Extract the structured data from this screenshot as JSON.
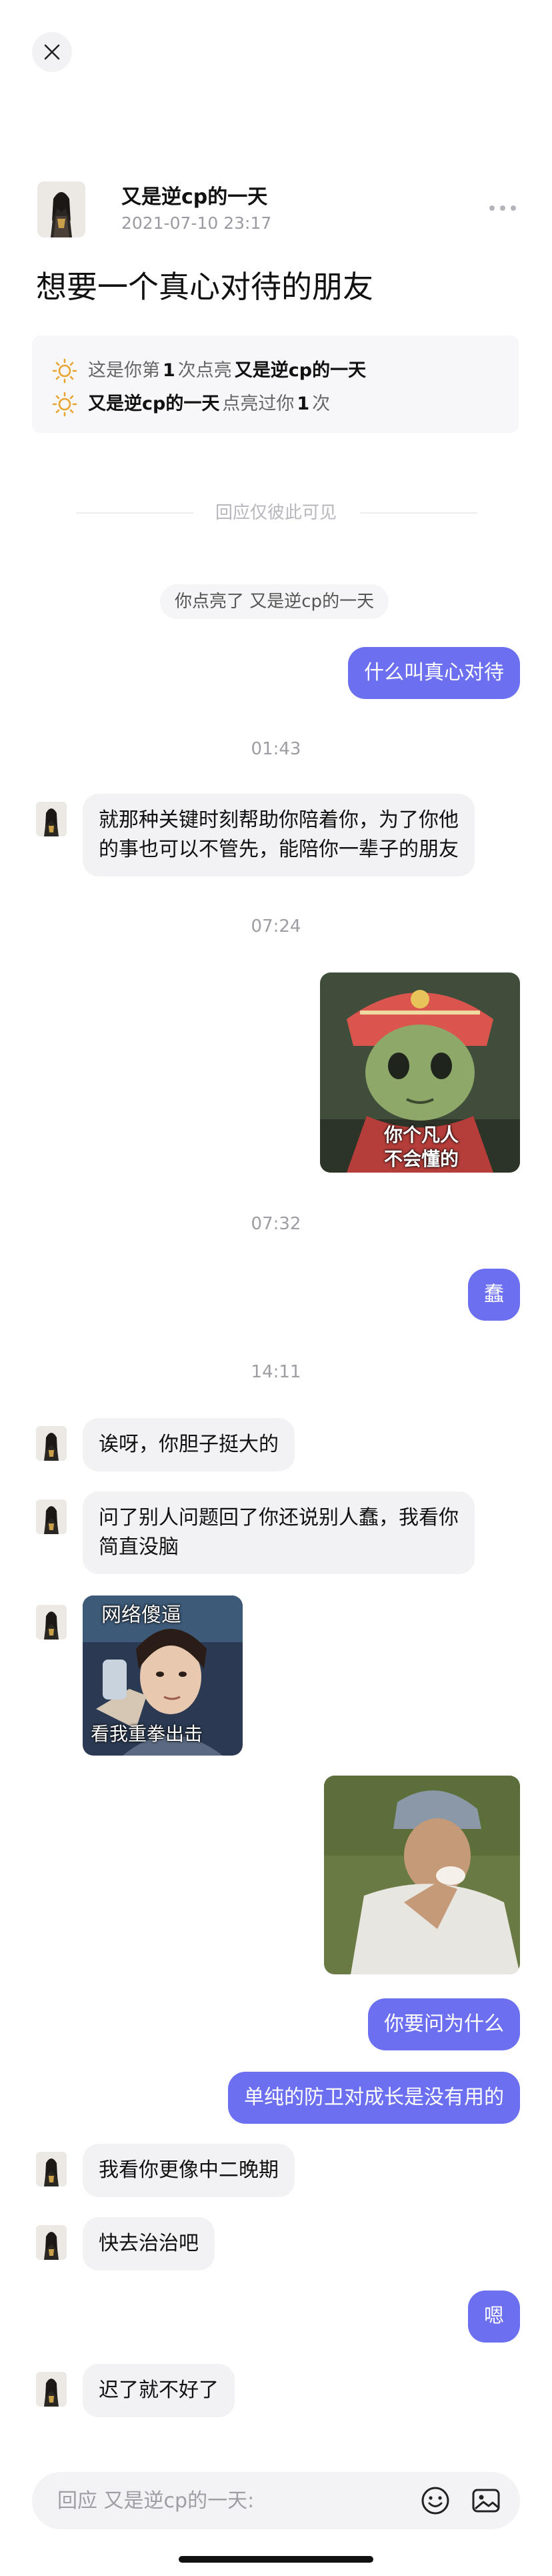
{
  "post": {
    "author_name": "又是逆cp的一天",
    "timestamp": "2021-07-10 23:17",
    "title": "想要一个真心对待的朋友"
  },
  "light_info": {
    "row1_prefix": "这是你第",
    "row1_count": "1",
    "row1_mid": "次点亮",
    "row1_name": "又是逆cp的一天",
    "row2_name": "又是逆cp的一天",
    "row2_mid": "点亮过你",
    "row2_count": "1",
    "row2_suffix": "次"
  },
  "divider_text": "回应仅彼此可见",
  "system_notice": "你点亮了 又是逆cp的一天",
  "times": [
    "01:43",
    "07:24",
    "07:32",
    "14:11"
  ],
  "messages": {
    "m1": "什么叫真心对待",
    "m2_line1": "就那种关键时刻帮助你陪着你，为了你他",
    "m2_line2": "的事也可以不管先，能陪你一辈子的朋友",
    "m3_caption_line1": "你个凡人",
    "m3_caption_line2": "不会懂的",
    "m4": "蠢",
    "m5": "诶呀，你胆子挺大的",
    "m6_line1": "问了别人问题回了你还说别人蠢，我看你",
    "m6_line2": "简直没脑",
    "m7_caption_top": "网络傻逼",
    "m7_caption_bottom": "看我重拳出击",
    "m9": "你要问为什么",
    "m10": "单纯的防卫对成长是没有用的",
    "m11": "我看你更像中二晚期",
    "m12": "快去治治吧",
    "m13": "嗯",
    "m14": "迟了就不好了"
  },
  "composer": {
    "placeholder": "回应 又是逆cp的一天:"
  },
  "icons": {
    "close": "close-icon",
    "more": "more-icon",
    "sun": "sun-icon",
    "emoji": "emoji-icon",
    "image": "image-icon"
  },
  "colors": {
    "accent": "#6b6ff0",
    "bubble_in": "#f2f1f4",
    "sun": "#e8a530"
  }
}
